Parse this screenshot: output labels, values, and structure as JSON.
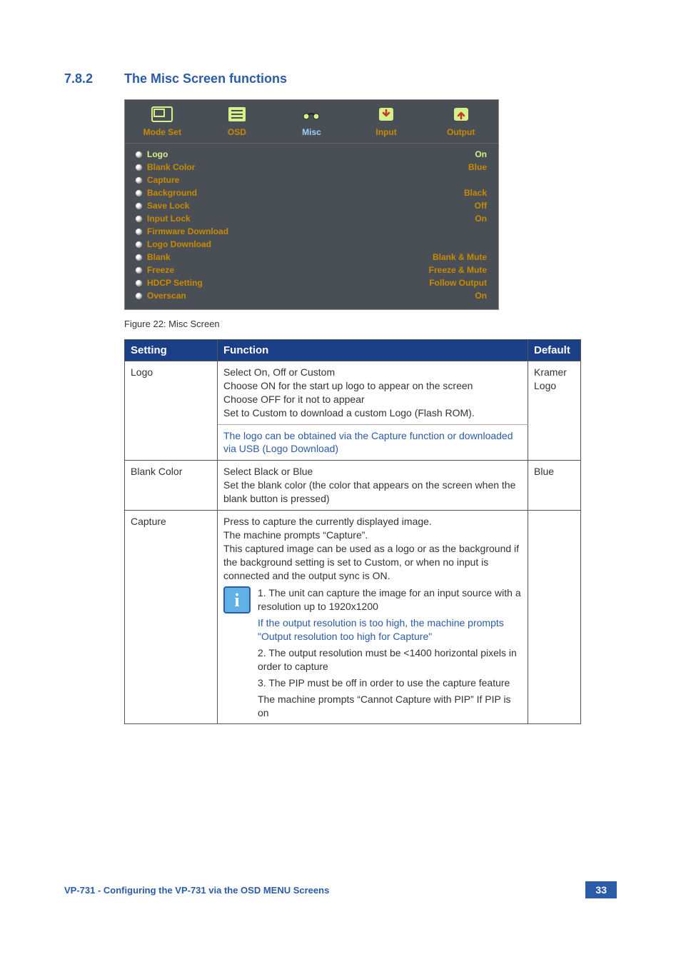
{
  "section": {
    "number": "7.8.2",
    "title": "The Misc Screen functions"
  },
  "osd": {
    "tabs": [
      {
        "label": "Mode Set",
        "icon": "modeset"
      },
      {
        "label": "OSD",
        "icon": "osd"
      },
      {
        "label": "Misc",
        "icon": "misc",
        "active": true
      },
      {
        "label": "Input",
        "icon": "input"
      },
      {
        "label": "Output",
        "icon": "output"
      }
    ],
    "rows": [
      {
        "label": "Logo",
        "value": "On",
        "selected": true
      },
      {
        "label": "Blank Color",
        "value": "Blue"
      },
      {
        "label": "Capture",
        "value": ""
      },
      {
        "label": "Background",
        "value": "Black"
      },
      {
        "label": "Save Lock",
        "value": "Off"
      },
      {
        "label": "Input Lock",
        "value": "On"
      },
      {
        "label": "Firmware Download",
        "value": ""
      },
      {
        "label": "Logo Download",
        "value": ""
      },
      {
        "label": "Blank",
        "value": "Blank & Mute"
      },
      {
        "label": "Freeze",
        "value": "Freeze & Mute"
      },
      {
        "label": "HDCP Setting",
        "value": "Follow Output"
      },
      {
        "label": "Overscan",
        "value": "On"
      }
    ]
  },
  "caption": "Figure 22: Misc Screen",
  "table": {
    "headers": {
      "setting": "Setting",
      "function": "Function",
      "default": "Default"
    },
    "rows": {
      "logo": {
        "setting": "Logo",
        "l1": "Select On, Off or Custom",
        "l2": "Choose ON for the start up logo to appear on the screen",
        "l3": "Choose OFF for it not to appear",
        "l4": "Set to Custom to download a custom Logo (Flash ROM).",
        "note": "The logo can be obtained via the Capture function or downloaded via USB (Logo Download)",
        "default": "Kramer Logo"
      },
      "blank": {
        "setting": "Blank Color",
        "l1": "Select Black or Blue",
        "l2": "Set the blank color (the color that appears on the screen when the blank button is pressed)",
        "default": "Blue"
      },
      "capture": {
        "setting": "Capture",
        "p1": "Press to capture the currently displayed image.",
        "p2": "The machine prompts “Capture”.",
        "p3": "This captured image can be used as a logo or as the background if the background setting is set to Custom, or when no input is connected and the output sync is ON.",
        "n1": "1. The unit can capture the image for an input source with a resolution up to 1920x1200",
        "note": "If the output resolution is too high, the machine prompts \"Output resolution too high for Capture\"",
        "n2": "2. The output resolution must be <1400 horizontal pixels in order to capture",
        "n3": "3. The PIP must be off in order to use the capture feature",
        "n4": "The machine prompts “Cannot Capture with PIP” If PIP is on",
        "default": ""
      }
    }
  },
  "footer": {
    "text": "VP-731 - Configuring the VP-731 via the OSD MENU Screens",
    "page": "33"
  }
}
